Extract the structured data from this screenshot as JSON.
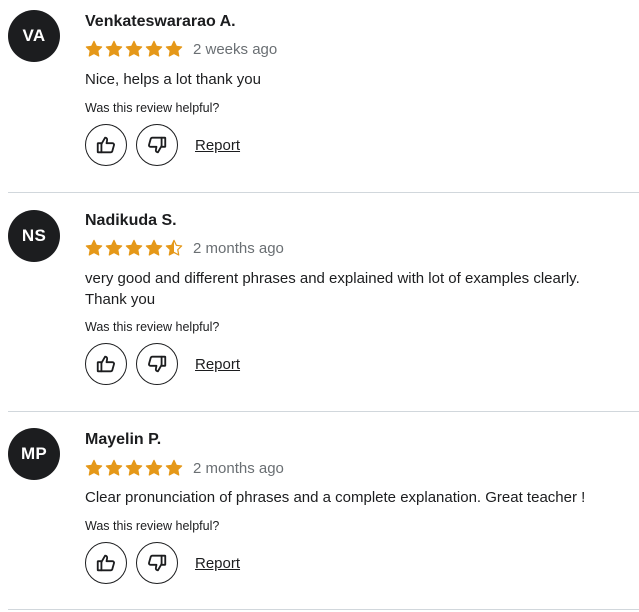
{
  "colors": {
    "star": "#e59819",
    "text": "#1c1d1f",
    "muted": "#6a6f73",
    "divider": "#d1d7dc",
    "avatar_bg": "#1c1d1f"
  },
  "icons": {
    "star": "star-icon",
    "like": "thumbs-up-icon",
    "dislike": "thumbs-down-icon"
  },
  "reviews": [
    {
      "initials": "VA",
      "name": "Venkateswararao A.",
      "rating": 5,
      "time": "2 weeks ago",
      "content": "Nice, helps a lot thank you",
      "helpful_prompt": "Was this review helpful?",
      "report_label": "Report"
    },
    {
      "initials": "NS",
      "name": "Nadikuda S.",
      "rating": 4.5,
      "time": "2 months ago",
      "content": "very good and different phrases and explained with lot of examples clearly. Thank you",
      "helpful_prompt": "Was this review helpful?",
      "report_label": "Report"
    },
    {
      "initials": "MP",
      "name": "Mayelin P.",
      "rating": 5,
      "time": "2 months ago",
      "content": "Clear pronunciation of phrases and a complete explanation. Great teacher !",
      "helpful_prompt": "Was this review helpful?",
      "report_label": "Report"
    }
  ]
}
